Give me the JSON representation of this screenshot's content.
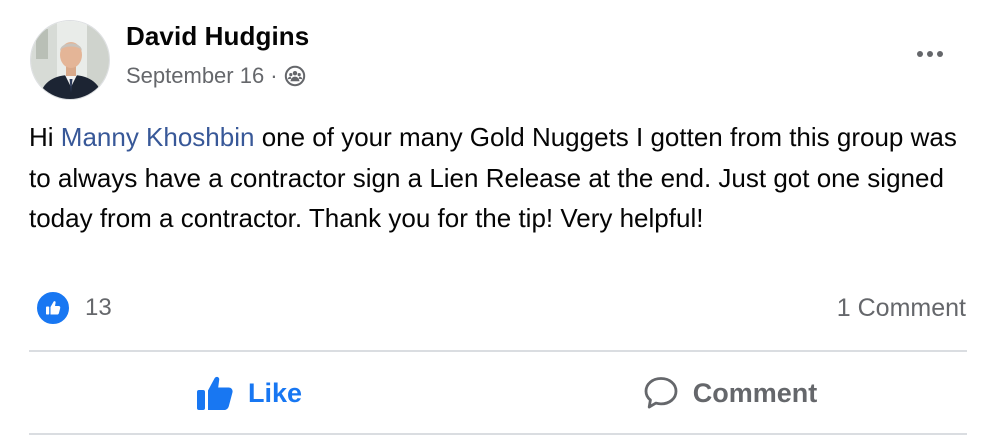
{
  "post": {
    "author": "David Hudgins",
    "date": "September 16",
    "separator": "·",
    "privacy_icon": "group-icon",
    "more_icon": "more-horizontal-icon",
    "text_prefix": "Hi ",
    "mention": "Manny Khoshbin",
    "text_body": " one of your many Gold Nuggets I gotten from this group was to always have a contractor sign a Lien Release at the end.  Just got one signed today from a contractor.  Thank you for the tip! Very helpful!",
    "reaction_icon": "like-icon",
    "reaction_count": "13",
    "comment_count_label": "1 Comment"
  },
  "actions": {
    "like_label": "Like",
    "comment_label": "Comment"
  },
  "colors": {
    "accent": "#1877f2",
    "mention": "#385898",
    "secondary_text": "#65676b",
    "divider": "#dadde1"
  }
}
